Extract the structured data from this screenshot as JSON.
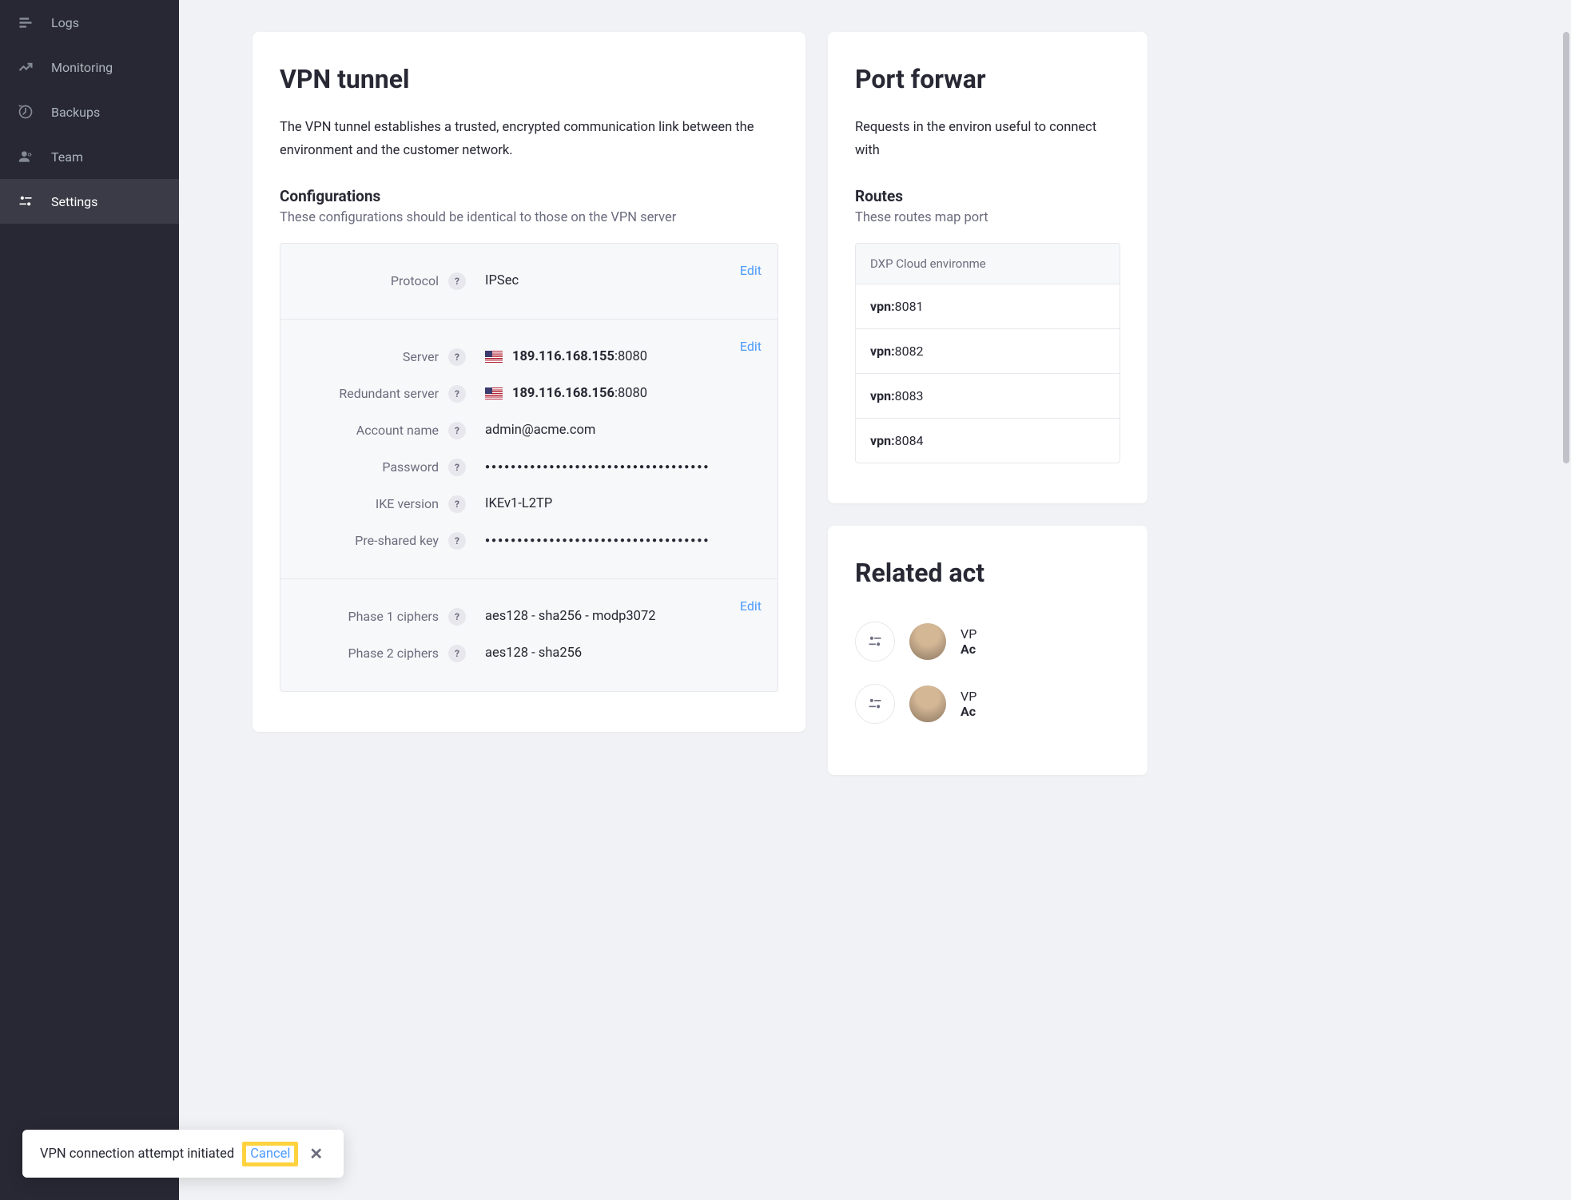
{
  "sidebar": {
    "items": [
      {
        "label": "Logs"
      },
      {
        "label": "Monitoring"
      },
      {
        "label": "Backups"
      },
      {
        "label": "Team"
      },
      {
        "label": "Settings"
      }
    ]
  },
  "vpn": {
    "title": "VPN tunnel",
    "description": "The VPN tunnel establishes a trusted, encrypted communication link between the environment and  the customer network.",
    "config_heading": "Configurations",
    "config_sub": "These configurations should be identical to those on the VPN server",
    "edit_label": "Edit",
    "protocol": {
      "label": "Protocol",
      "value": "IPSec"
    },
    "server": {
      "label": "Server",
      "ip": "189.116.168.155",
      "port": ":8080"
    },
    "redundant": {
      "label": "Redundant server",
      "ip": "189.116.168.156",
      "port": ":8080"
    },
    "account": {
      "label": "Account name",
      "value": "admin@acme.com"
    },
    "password": {
      "label": "Password",
      "value": "●●●●●●●●●●●●●●●●●●●●●●●●●●●●●●●●●●●"
    },
    "ike": {
      "label": "IKE version",
      "value": "IKEv1-L2TP"
    },
    "psk": {
      "label": "Pre-shared key",
      "value": "●●●●●●●●●●●●●●●●●●●●●●●●●●●●●●●●●●●"
    },
    "phase1": {
      "label": "Phase 1 ciphers",
      "value": "aes128 - sha256 - modp3072"
    },
    "phase2": {
      "label": "Phase 2 ciphers",
      "value": "aes128 - sha256"
    }
  },
  "port_forwarding": {
    "title": "Port forwar",
    "description": "Requests in the environ useful to connect with",
    "routes_heading": "Routes",
    "routes_sub": "These routes map port",
    "table_header": "DXP Cloud environme",
    "prefix": "vpn:",
    "rows": [
      "8081",
      "8082",
      "8083",
      "8084"
    ]
  },
  "related": {
    "title": "Related act",
    "item_text_prefix": "VP",
    "item_text_bold": "Ac"
  },
  "toast": {
    "message": "VPN connection attempt initiated",
    "cancel": "Cancel"
  }
}
